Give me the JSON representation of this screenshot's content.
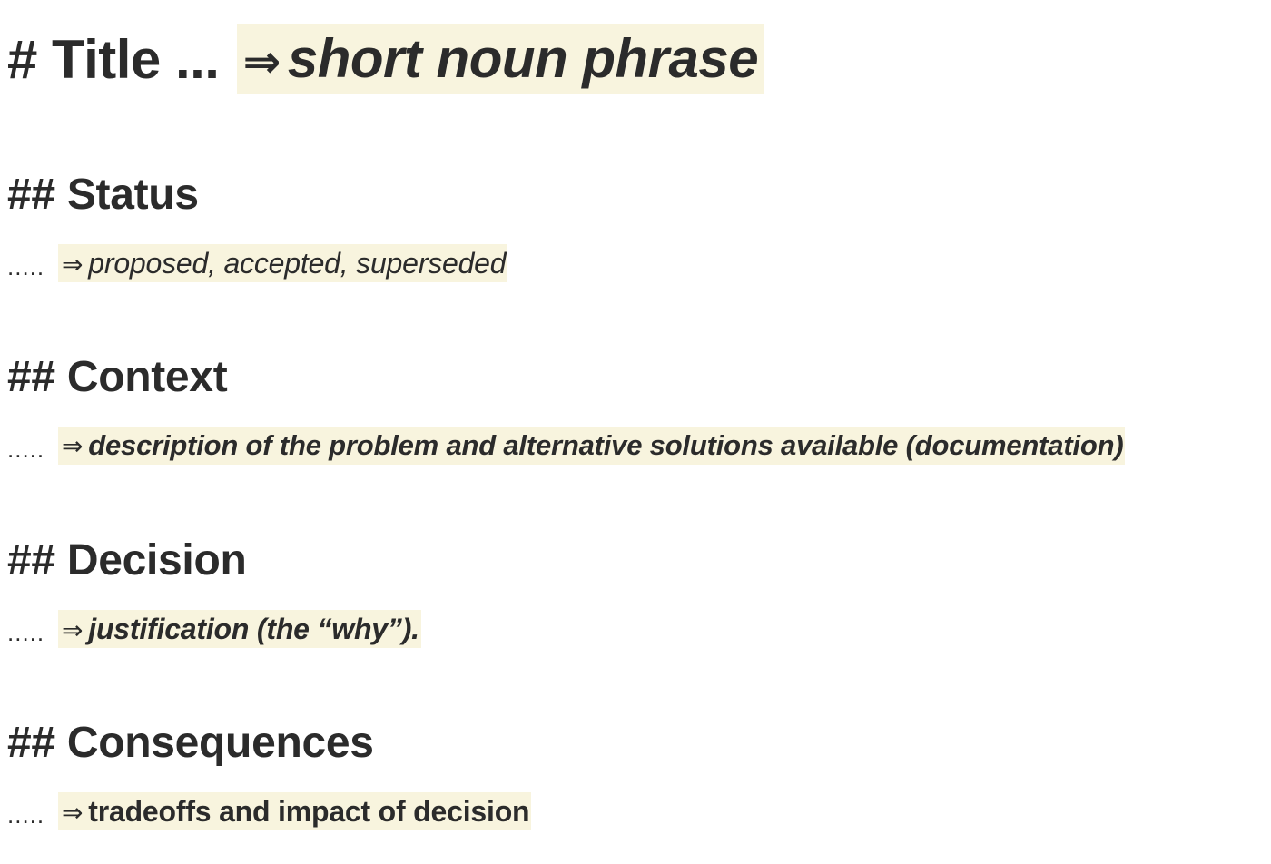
{
  "title": {
    "text": "# Title ...",
    "arrow": "⇒",
    "note": "short noun phrase"
  },
  "sections": [
    {
      "heading": "## Status",
      "dots": ".....",
      "arrow": "⇒",
      "note": "proposed, accepted, superseded"
    },
    {
      "heading": "## Context",
      "dots": ".....",
      "arrow": "⇒",
      "note": "description of the problem and alternative solutions available (documentation)"
    },
    {
      "heading": "## Decision",
      "dots": ".....",
      "arrow": "⇒",
      "note": "justification (the “why”)."
    },
    {
      "heading": "## Consequences",
      "dots": ".....",
      "arrow": "⇒",
      "note": "tradeoffs and impact of decision"
    }
  ],
  "colors": {
    "text": "#2b2b2b",
    "highlight": "#f8f4de",
    "background": "#ffffff"
  }
}
